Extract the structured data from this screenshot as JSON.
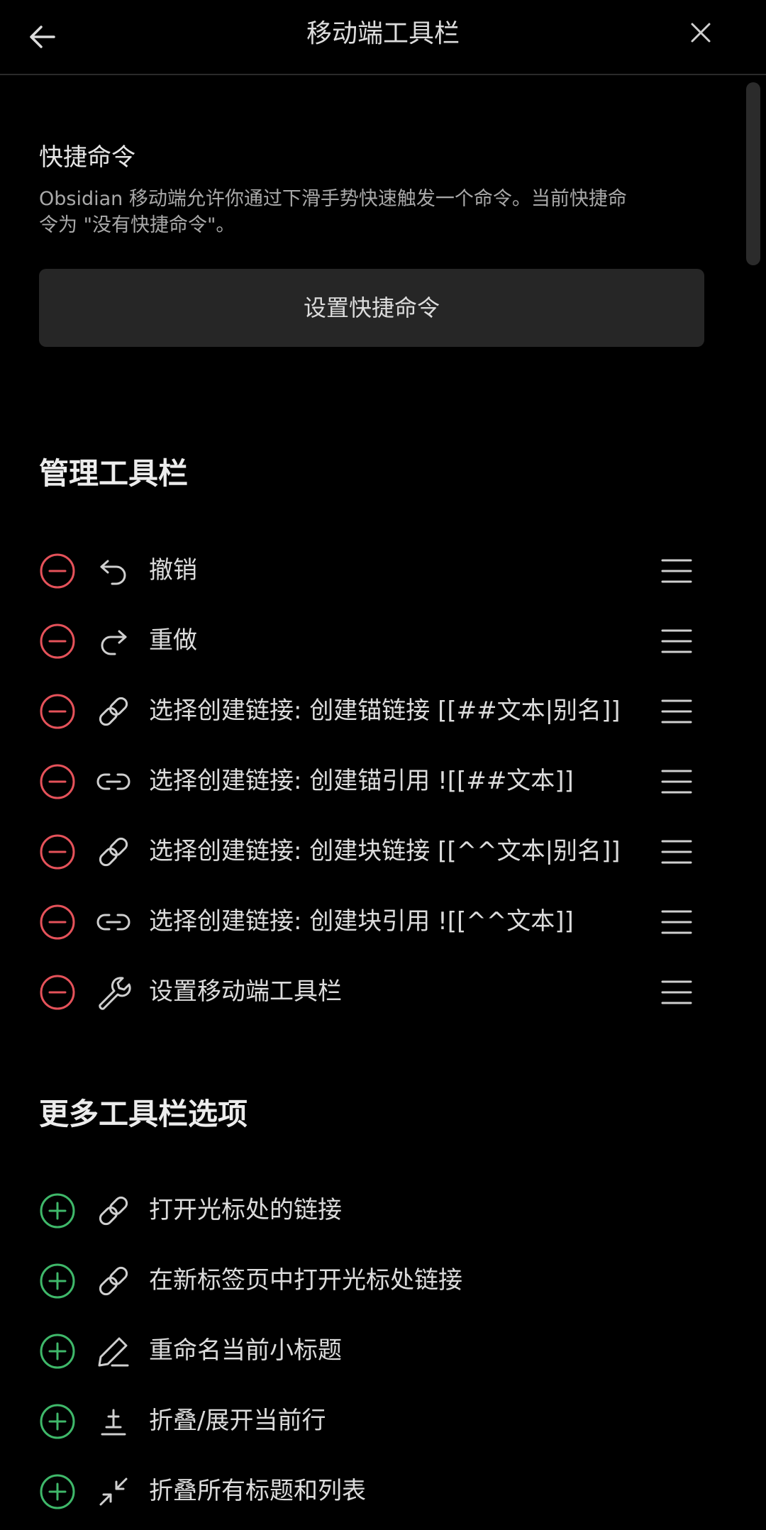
{
  "header": {
    "title": "移动端工具栏",
    "back_icon": "arrow-left-icon",
    "close_icon": "close-icon"
  },
  "quick_command": {
    "label": "快捷命令",
    "description_line1": "Obsidian 移动端允许你通过下滑手势快速触发一个命令。当前快捷命",
    "description_line2": "令为 \"没有快捷命令\"。",
    "button_label": "设置快捷命令"
  },
  "manage_toolbar": {
    "heading": "管理工具栏",
    "items": [
      {
        "label": "撤销",
        "icon": "undo-icon"
      },
      {
        "label": "重做",
        "icon": "redo-icon"
      },
      {
        "label": "选择创建链接: 创建锚链接 [[##文本|别名]]",
        "icon": "link-icon"
      },
      {
        "label": "选择创建链接: 创建锚引用 ![[##文本]]",
        "icon": "link-horizontal-icon"
      },
      {
        "label": "选择创建链接: 创建块链接 [[^^文本|别名]]",
        "icon": "link-icon"
      },
      {
        "label": "选择创建链接: 创建块引用 ![[^^文本]]",
        "icon": "link-horizontal-icon"
      },
      {
        "label": "设置移动端工具栏",
        "icon": "wrench-icon"
      }
    ]
  },
  "more_options": {
    "heading": "更多工具栏选项",
    "items": [
      {
        "label": "打开光标处的链接",
        "icon": "link-icon"
      },
      {
        "label": "在新标签页中打开光标处链接",
        "icon": "link-icon"
      },
      {
        "label": "重命名当前小标题",
        "icon": "pencil-icon"
      },
      {
        "label": "折叠/展开当前行",
        "icon": "fold-icon"
      },
      {
        "label": "折叠所有标题和列表",
        "icon": "collapse-all-icon"
      }
    ]
  },
  "colors": {
    "background": "#000000",
    "remove": "#e5525a",
    "add": "#3fb86a",
    "button_bg": "#262626",
    "text": "#dcdcdc",
    "muted": "#a9a9a9"
  }
}
